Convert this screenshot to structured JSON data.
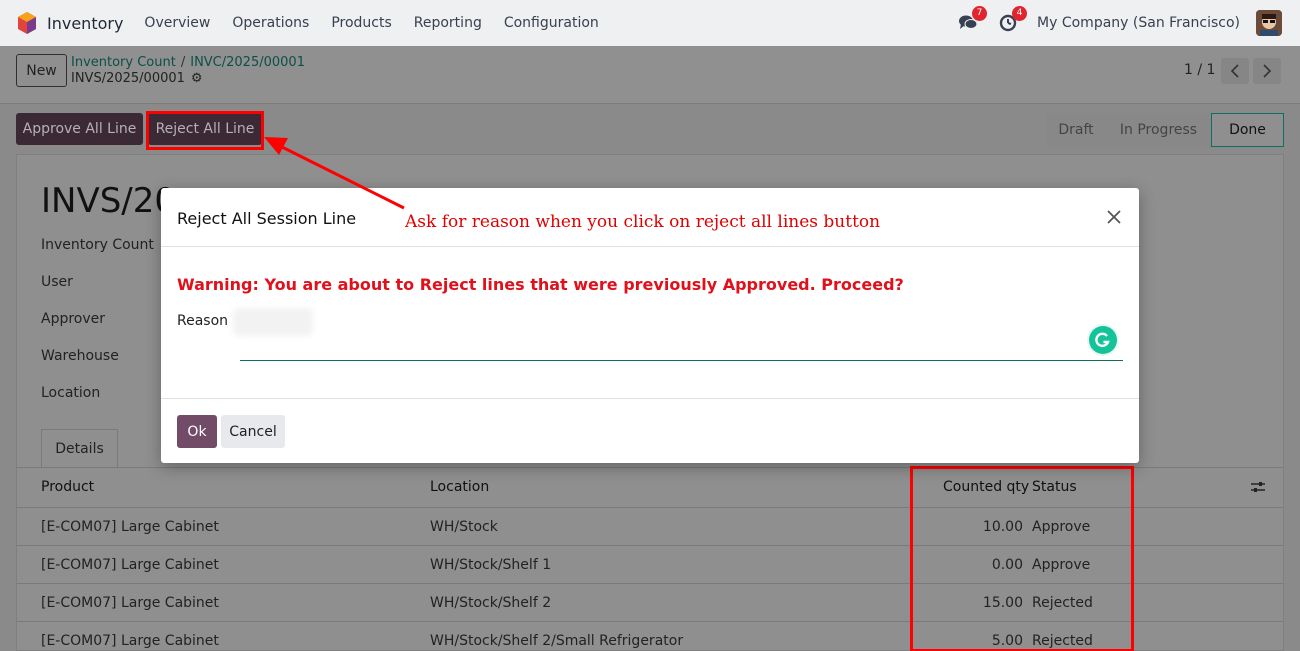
{
  "navbar": {
    "app_name": "Inventory",
    "menu": [
      "Overview",
      "Operations",
      "Products",
      "Reporting",
      "Configuration"
    ],
    "messages_count": "7",
    "activities_count": "4",
    "company": "My Company (San Francisco)"
  },
  "control": {
    "new_label": "New",
    "breadcrumb": [
      "Inventory Count",
      "INVC/2025/00001"
    ],
    "record_name": "INVS/2025/00001",
    "pager": "1 / 1"
  },
  "statusbar": {
    "approve_label": "Approve All Line",
    "reject_label": "Reject All Line",
    "stages": [
      "Draft",
      "In Progress",
      "Done"
    ],
    "active_stage": "Done"
  },
  "form": {
    "title": "INVS/20",
    "fields": [
      "Inventory Count",
      "User",
      "Approver",
      "Warehouse",
      "Location"
    ],
    "tab": "Details"
  },
  "table": {
    "headers": {
      "product": "Product",
      "location": "Location",
      "counted": "Counted qty",
      "status": "Status"
    },
    "rows": [
      {
        "product": "[E-COM07] Large Cabinet",
        "location": "WH/Stock",
        "counted": "10.00",
        "status": "Approve"
      },
      {
        "product": "[E-COM07] Large Cabinet",
        "location": "WH/Stock/Shelf 1",
        "counted": "0.00",
        "status": "Approve"
      },
      {
        "product": "[E-COM07] Large Cabinet",
        "location": "WH/Stock/Shelf 2",
        "counted": "15.00",
        "status": "Rejected"
      },
      {
        "product": "[E-COM07] Large Cabinet",
        "location": "WH/Stock/Shelf 2/Small Refrigerator",
        "counted": "5.00",
        "status": "Rejected"
      }
    ]
  },
  "dialog": {
    "title": "Reject All Session Line",
    "warning": "Warning: You are about to Reject lines that were previously Approved. Proceed?",
    "reason_label": "Reason",
    "reason_value": "",
    "ok_label": "Ok",
    "cancel_label": "Cancel"
  },
  "annotation": {
    "text": "Ask for reason when you click on reject all lines button",
    "color": "#e00000"
  },
  "colors": {
    "primary": "#714b67",
    "link": "#0e6e62",
    "warning": "#e0111b",
    "highlight": "#ff0000"
  }
}
